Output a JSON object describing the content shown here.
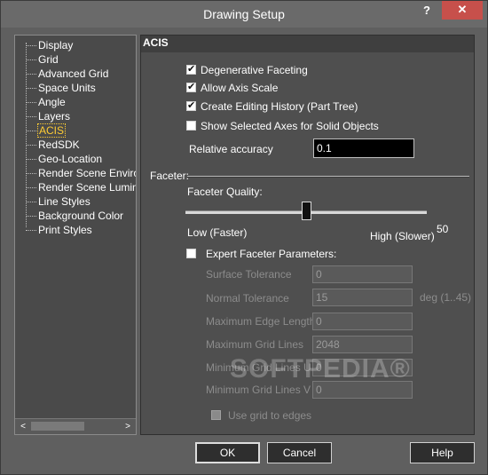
{
  "window": {
    "title": "Drawing Setup",
    "help_glyph": "?",
    "close_glyph": "✕"
  },
  "tree": {
    "items": [
      {
        "label": "Display"
      },
      {
        "label": "Grid"
      },
      {
        "label": "Advanced Grid"
      },
      {
        "label": "Space Units"
      },
      {
        "label": "Angle"
      },
      {
        "label": "Layers"
      },
      {
        "label": "ACIS",
        "selected": true
      },
      {
        "label": "RedSDK"
      },
      {
        "label": "Geo-Location"
      },
      {
        "label": "Render Scene Environment"
      },
      {
        "label": "Render Scene Luminance"
      },
      {
        "label": "Line Styles"
      },
      {
        "label": "Background Color"
      },
      {
        "label": "Print Styles"
      }
    ],
    "scroll_left": "<",
    "scroll_right": ">"
  },
  "panel": {
    "header": "ACIS",
    "options": {
      "degenerative": {
        "label": "Degenerative Faceting",
        "checked": true
      },
      "axis_scale": {
        "label": "Allow Axis Scale",
        "checked": true
      },
      "editing_history": {
        "label": "Create Editing History (Part Tree)",
        "checked": true
      },
      "selected_axes": {
        "label": "Show Selected Axes for Solid Objects",
        "checked": false
      }
    },
    "relative_accuracy": {
      "label": "Relative accuracy",
      "value": "0.1"
    },
    "faceter": {
      "section_label": "Faceter:",
      "quality_label": "Faceter Quality:",
      "low_label": "Low (Faster)",
      "high_label": "High (Slower)",
      "value": "50",
      "slider_fraction": 0.5
    },
    "expert": {
      "label": "Expert Faceter Parameters:",
      "checked": false,
      "fields": [
        {
          "label": "Surface Tolerance",
          "value": "0"
        },
        {
          "label": "Normal Tolerance",
          "value": "15",
          "unit": "deg (1..45)"
        },
        {
          "label": "Maximum Edge Length",
          "value": "0"
        },
        {
          "label": "Maximum Grid Lines",
          "value": "2048"
        },
        {
          "label": "Minimum Grid Lines U",
          "value": "0"
        },
        {
          "label": "Minimum Grid Lines V",
          "value": "0"
        }
      ],
      "use_grid": {
        "label": "Use grid to edges",
        "checked": false
      }
    }
  },
  "buttons": {
    "ok": "OK",
    "cancel": "Cancel",
    "help": "Help"
  },
  "watermark": "SOFTPEDIA®",
  "colors": {
    "selected_item": "#ffcc33",
    "close_button": "#c7504b"
  }
}
